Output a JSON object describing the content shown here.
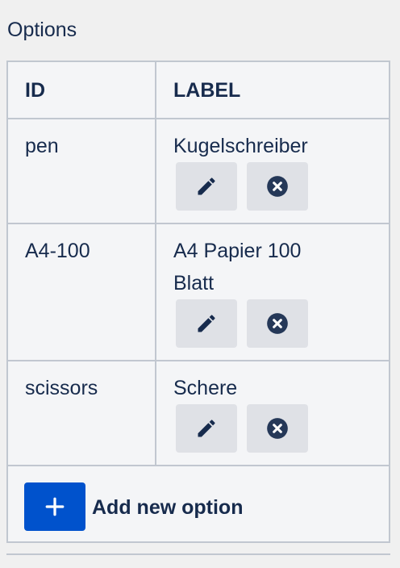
{
  "section": {
    "title": "Options"
  },
  "table": {
    "headers": {
      "id": "ID",
      "label": "LABEL"
    },
    "rows": [
      {
        "id": "pen",
        "label": "Kugelschreiber"
      },
      {
        "id": "A4-100",
        "label_line1": "A4 Papier 100",
        "label_line2": "Blatt"
      },
      {
        "id": "scissors",
        "label": "Schere"
      }
    ]
  },
  "add": {
    "label": "Add new option"
  },
  "icons": {
    "edit": "pencil-icon",
    "remove": "close-circle-icon",
    "add": "plus-icon"
  },
  "colors": {
    "text": "#172b4d",
    "primary": "#0052cc",
    "button_bg": "#dfe1e6",
    "border": "#c1c7d0"
  }
}
